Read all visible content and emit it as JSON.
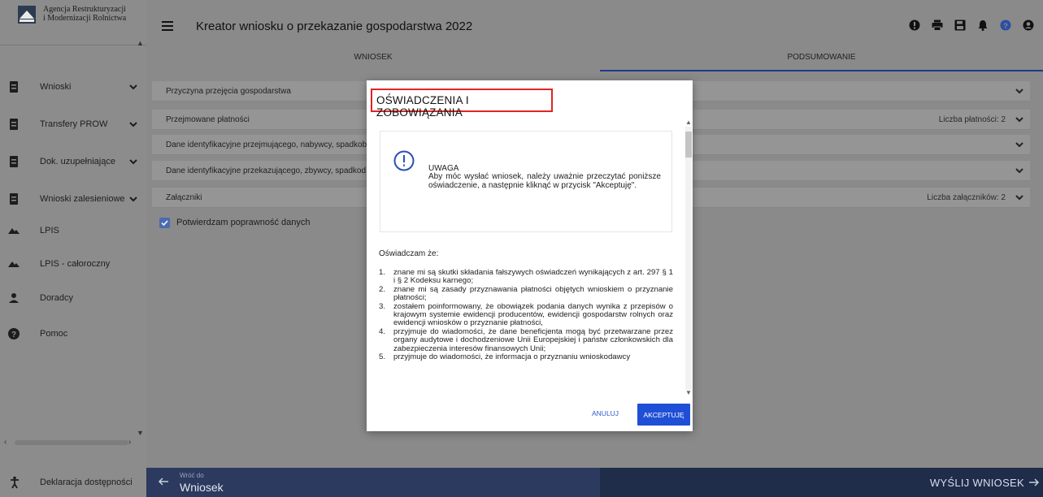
{
  "logo": {
    "line1": "Agencja Restrukturyzacji",
    "line2": "i Modernizacji Rolnictwa"
  },
  "sidebar": {
    "items": [
      {
        "label": "Wnioski",
        "icon": "document-icon",
        "chevron": true
      },
      {
        "label": "Transfery PROW",
        "icon": "document-icon",
        "chevron": true
      },
      {
        "label": "Dok. uzupełniające",
        "icon": "document-icon",
        "chevron": true
      },
      {
        "label": "Wnioski zalesieniowe",
        "icon": "document-icon",
        "chevron": true
      },
      {
        "label": "LPIS",
        "icon": "terrain-icon",
        "chevron": false
      },
      {
        "label": "LPIS - całoroczny",
        "icon": "terrain-icon",
        "chevron": false
      },
      {
        "label": "Doradcy",
        "icon": "person-icon",
        "chevron": false
      },
      {
        "label": "Pomoc",
        "icon": "help-icon",
        "chevron": false
      }
    ],
    "footer": {
      "label": "Deklaracja dostępności",
      "icon": "accessibility-icon"
    }
  },
  "header": {
    "title": "Kreator wniosku o przekazanie gospodarstwa 2022",
    "icons": [
      "alert-icon",
      "print-icon",
      "save-icon",
      "bell-icon",
      "help-icon",
      "account-icon"
    ]
  },
  "tabs": [
    {
      "label": "WNIOSEK",
      "active": false
    },
    {
      "label": "PODSUMOWANIE",
      "active": true
    }
  ],
  "accordion": [
    {
      "label": "Przyczyna przejęcia gospodarstwa",
      "right": ""
    },
    {
      "label": "Przejmowane płatności",
      "right": "Liczba płatności: 2"
    },
    {
      "label": "Dane identyfikacyjne przejmującego, nabywcy, spadkob",
      "right": ""
    },
    {
      "label": "Dane identyfikacyjne przekazującego, zbywcy, spadkod",
      "right": ""
    },
    {
      "label": "Załączniki",
      "right": "Liczba załączników: 2"
    }
  ],
  "confirm": {
    "label": "Potwierdzam poprawność danych",
    "checked": true
  },
  "bottom": {
    "back_small": "Wróć do",
    "back_big": "Wniosek",
    "send": "WYŚLIJ WNIOSEK"
  },
  "modal": {
    "title": "OŚWIADCZENIA I ZOBOWIĄZANIA",
    "warning_title": "UWAGA",
    "warning_text": "Aby móc wysłać wniosek, należy uważnie przeczytać poniższe oświadczenie, a następnie kliknąć w przycisk \"Akceptuję\".",
    "intro": "Oświadczam że:",
    "items": [
      "znane mi są skutki składania fałszywych oświadczeń wynikających z art. 297 § 1 i § 2 Kodeksu karnego;",
      "znane mi są zasady przyznawania płatności objętych wnioskiem o przyznanie płatności;",
      "zostałem poinformowany, że obowiązek podania danych wynika z przepisów o krajowym systemie ewidencji producentów, ewidencji gospodarstw rolnych oraz ewidencji wniosków o przyznanie płatności,",
      "przyjmuje do wiadomości, że dane beneficjenta mogą być przetwarzane przez organy audytowe i dochodzeniowe Unii Europejskiej i państw członkowskich dla zabezpieczenia interesów finansowych Unii;",
      "przyjmuje do wiadomości, że informacja o przyznaniu wnioskodawcy"
    ],
    "cancel_label": "ANULUJ",
    "accept_label": "AKCEPTUJĘ"
  },
  "colors": {
    "accent": "#1f4fd6",
    "title_border": "#e02424",
    "bottom_bar": "#2b3a5e"
  }
}
